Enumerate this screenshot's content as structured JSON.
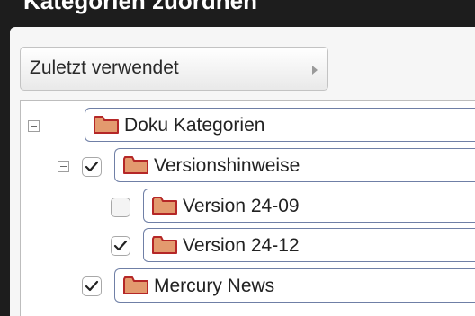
{
  "dialog": {
    "title": "Kategorien zuordnen"
  },
  "recent": {
    "label": "Zuletzt verwendet",
    "arrow_icon": "triangle-right-icon"
  },
  "tree": {
    "folder_icon": "folder-icon",
    "folder_color": "#e39a6e",
    "folder_outline": "#b52727",
    "nodes": [
      {
        "id": "doku-kategorien",
        "label": "Doku Kategorien",
        "expander": "collapse",
        "checked": null
      },
      {
        "id": "versionshinweise",
        "label": "Versionshinweise",
        "expander": "collapse",
        "checked": true
      },
      {
        "id": "version-24-09",
        "label": "Version 24-09",
        "expander": null,
        "checked": false
      },
      {
        "id": "version-24-12",
        "label": "Version 24-12",
        "expander": null,
        "checked": true
      },
      {
        "id": "mercury-news",
        "label": "Mercury News",
        "expander": null,
        "checked": true
      }
    ]
  }
}
